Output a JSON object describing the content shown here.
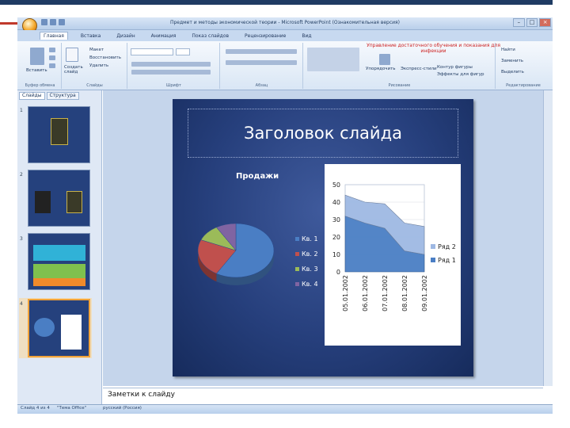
{
  "window": {
    "title": "Предмет и методы экономической теории - Microsoft PowerPoint (Ознакомительная версия)"
  },
  "ribbon_tabs": [
    "Главная",
    "Вставка",
    "Дизайн",
    "Анимация",
    "Показ слайдов",
    "Рецензирование",
    "Вид"
  ],
  "ribbon": {
    "groups": {
      "clipboard": "Буфер обмена",
      "slides": "Слайды",
      "font": "Шрифт",
      "paragraph": "Абзац",
      "drawing": "Рисование",
      "editing": "Редактирование"
    },
    "buttons": {
      "paste": "Вставить",
      "create_slide": "Создать слайд",
      "layout": "Макет",
      "restore": "Восстановить",
      "delete": "Удалить",
      "arrange": "Упорядочить",
      "quick_styles": "Экспресс-стили",
      "shape_outline": "Контур фигуры",
      "shape_effects": "Эффекты для фигур",
      "find": "Найти",
      "replace": "Заменить",
      "select": "Выделить"
    },
    "drawing_tip": "Управление достаточного обучения и показания для инфекции"
  },
  "left_panel": {
    "tabs": [
      "Слайды",
      "Структура"
    ],
    "thumbnails": [
      "1",
      "2",
      "3",
      "4"
    ]
  },
  "slide": {
    "title": "Заголовок слайда"
  },
  "notes": {
    "text": "Заметки к слайду"
  },
  "status": {
    "slide": "Слайд 4 из 4",
    "theme": "\"Тема Office\"",
    "language": "русский (Россия)"
  },
  "chart_data": [
    {
      "type": "pie",
      "title": "Продажи",
      "categories": [
        "Кв. 1",
        "Кв. 2",
        "Кв. 3",
        "Кв. 4"
      ],
      "values": [
        8.2,
        3.2,
        1.4,
        1.2
      ],
      "colors": [
        "#4a7ec4",
        "#c0504d",
        "#9bbb59",
        "#8064a2"
      ]
    },
    {
      "type": "area",
      "categories": [
        "05.01.2002",
        "06.01.2002",
        "07.01.2002",
        "08.01.2002",
        "09.01.2002"
      ],
      "series": [
        {
          "name": "Ряд 1",
          "values": [
            32,
            28,
            25,
            12,
            10
          ],
          "color": "#4a7ec4"
        },
        {
          "name": "Ряд 2",
          "values": [
            12,
            12,
            14,
            16,
            16
          ],
          "color": "#9eb8e3"
        }
      ],
      "y_ticks": [
        "0",
        "10",
        "20",
        "30",
        "40",
        "50"
      ],
      "ylim": [
        0,
        50
      ],
      "legend": "right"
    }
  ]
}
